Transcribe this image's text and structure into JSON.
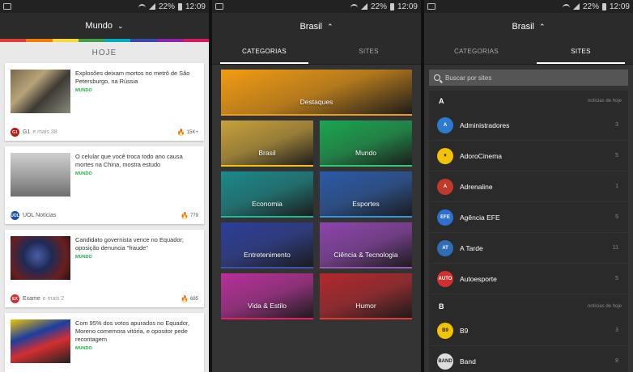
{
  "status": {
    "battery": "22%",
    "time": "12:09"
  },
  "screen1": {
    "header": "Mundo",
    "rainbow": [
      "#e53935",
      "#f57c00",
      "#fdd835",
      "#43a047",
      "#00acc1",
      "#3949ab",
      "#8e24aa",
      "#d81b60"
    ],
    "today_label": "HOJE",
    "cards": [
      {
        "title": "Explosões deixam mortos no metrô de São Petersburgo, na Rússia",
        "category": "MUNDO",
        "source": "G1",
        "more": "e mais 38",
        "count": "15K+",
        "logo": "G1",
        "logo_color": "#c4170c",
        "thumb": "metro"
      },
      {
        "title": "O celular que você troca todo ano causa mortes na China, mostra estudo",
        "category": "MUNDO",
        "source": "UOL Notícias",
        "more": "",
        "count": "779",
        "logo": "UOL",
        "logo_color": "#1e4fa8",
        "thumb": "fog"
      },
      {
        "title": "Candidato governista vence no Equador; oposição denuncia \"fraude\"",
        "category": "MUNDO",
        "source": "Exame",
        "more": "e mais 2",
        "count": "685",
        "logo": "EX",
        "logo_color": "#d32f2f",
        "thumb": "candidate"
      },
      {
        "title": "Com 95% dos votos apurados no Equador, Moreno comemora vitória, e opositor pede recontagem",
        "category": "MUNDO",
        "source": "",
        "more": "",
        "count": "",
        "logo": "",
        "logo_color": "#ccc",
        "thumb": "flags"
      }
    ]
  },
  "screen2": {
    "header": "Brasil",
    "tabs": [
      "CATEGORIAS",
      "SITES"
    ],
    "tiles": [
      {
        "label": "Destaques",
        "color": "#f39c12",
        "bar": "#f39c12"
      },
      {
        "label": "Brasil",
        "color": "#c8a13a",
        "bar": "#f1c40f"
      },
      {
        "label": "Mundo",
        "color": "#1aa64f",
        "bar": "#2ecc71"
      },
      {
        "label": "Economia",
        "color": "#1a8a8a",
        "bar": "#1abc9c"
      },
      {
        "label": "Esportes",
        "color": "#2a5aa8",
        "bar": "#3498db"
      },
      {
        "label": "Entretenimento",
        "color": "#2c3e9a",
        "bar": "#3f51b5"
      },
      {
        "label": "Ciência & Tecnologia",
        "color": "#8e44ad",
        "bar": "#9b59b6"
      },
      {
        "label": "Vida & Estilo",
        "color": "#b8309a",
        "bar": "#e91e63"
      },
      {
        "label": "Humor",
        "color": "#b3282d",
        "bar": "#e53935"
      }
    ]
  },
  "screen3": {
    "header": "Brasil",
    "tabs": [
      "CATEGORIAS",
      "SITES"
    ],
    "search_placeholder": "Buscar por sites",
    "section_a": {
      "letter": "A",
      "note": "notícias de hoje"
    },
    "section_b": {
      "letter": "B",
      "note": "notícias de hoje"
    },
    "sites_a": [
      {
        "name": "Administradores",
        "count": "3",
        "logo": "A",
        "color": "#2c7bd0"
      },
      {
        "name": "AdoroCinema",
        "count": "5",
        "logo": "▼",
        "color": "#f2c400"
      },
      {
        "name": "Adrenaline",
        "count": "1",
        "logo": "A",
        "color": "#c0392b"
      },
      {
        "name": "Agência EFE",
        "count": "5",
        "logo": "EFE",
        "color": "#2e6fd1"
      },
      {
        "name": "A Tarde",
        "count": "11",
        "logo": "AT",
        "color": "#2f6db5"
      },
      {
        "name": "Autoesporte",
        "count": "5",
        "logo": "AUTO",
        "color": "#d32f2f"
      }
    ],
    "sites_b": [
      {
        "name": "B9",
        "count": "3",
        "logo": "B9",
        "color": "#f2c400"
      },
      {
        "name": "Band",
        "count": "8",
        "logo": "BAND",
        "color": "#ddd"
      }
    ]
  }
}
